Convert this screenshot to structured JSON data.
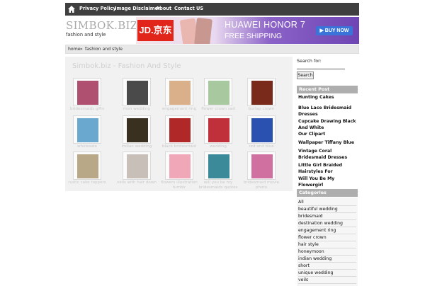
{
  "nav": {
    "home_icon": "home-icon",
    "links": [
      "Privacy Policy",
      "Image Disclaimer",
      "About",
      "Contact US"
    ]
  },
  "header": {
    "site_title": "SIMBOK.BIZ",
    "tagline": "fashion and style"
  },
  "ad": {
    "logo": "JD.京东",
    "headline": "HUAWEI HONOR 7",
    "sub": "FREE SHIPPING",
    "cta": "▶ BUY NOW",
    "accent": "#e1251b"
  },
  "breadcrumb": {
    "home": "home",
    "separator": "»",
    "current": "fashion and style"
  },
  "main": {
    "title": "Simbok.biz - Fashion And Style",
    "thumbs": [
      {
        "caption": "bridesmaids gifts",
        "color": "#b05070"
      },
      {
        "caption": "men wedding",
        "color": "#4a4a4a"
      },
      {
        "caption": "engagement ring",
        "color": "#d9b08a"
      },
      {
        "caption": "flower crown sad",
        "color": "#a8c8a0"
      },
      {
        "caption": "burlap crown",
        "color": "#7a2a1a"
      },
      {
        "caption": "wholesale",
        "color": "#6aa8d0"
      },
      {
        "caption": "indian wedding",
        "color": "#3a3020"
      },
      {
        "caption": "black bridesmaid",
        "color": "#b02828"
      },
      {
        "caption": "wedding",
        "color": "#c0303a"
      },
      {
        "caption": "red and blue",
        "color": "#2a50b0"
      },
      {
        "caption": "rustic cake toppers",
        "color": "#b8a888"
      },
      {
        "caption": "veils with hair down",
        "color": "#c8c0b8"
      },
      {
        "caption": "flowers illustration tumblr",
        "color": "#f0a8b8"
      },
      {
        "caption": "will you be my bridesmaids quotes",
        "color": "#3a8a9a"
      },
      {
        "caption": "bridesmaid movie photo",
        "color": "#d070a0"
      }
    ]
  },
  "sidebar": {
    "search_label": "Search for:",
    "search_value": "",
    "search_button": "Search",
    "recent_title": "Recent Post",
    "recent_posts": [
      "Hunting Cakes",
      "Blue Lace Bridesmaid Dresses",
      "Cupcake Drawing Black And White",
      "Our Clipart",
      "Wallpaper Tiffany Blue",
      "Vintage Coral Bridesmaid Dresses",
      "Little Girl Braided Hairstyles For",
      "Will You Be My Flowergirl"
    ],
    "categories_title": "Categories",
    "categories": [
      "All",
      "beautiful wedding",
      "bridesmaid",
      "destination wedding",
      "engagement ring",
      "flower crown",
      "hair style",
      "honeymoon",
      "indian wedding",
      "short",
      "unique wedding",
      "veils"
    ]
  }
}
